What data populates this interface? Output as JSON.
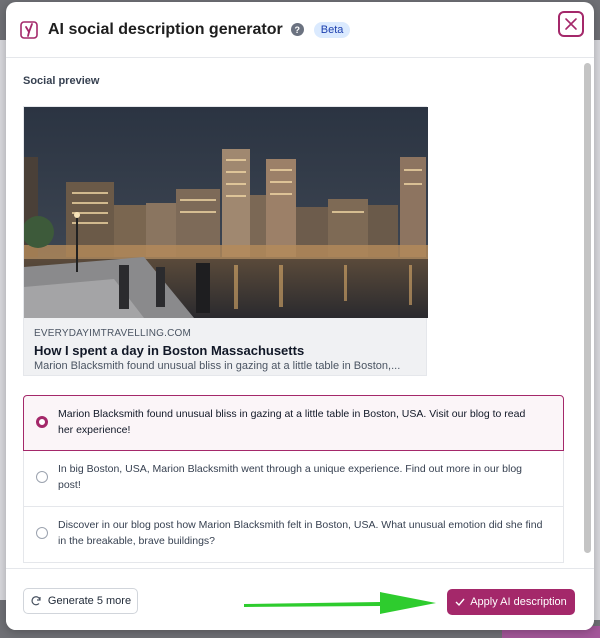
{
  "modal": {
    "title": "AI social description generator",
    "help_label": "?",
    "badge": "Beta"
  },
  "preview": {
    "section_label": "Social preview",
    "domain": "EVERYDAYIMTRAVELLING.COM",
    "title": "How I spent a day in Boston Massachusetts",
    "description": "Marion Blacksmith found unusual bliss in gazing at a little table in Boston,..."
  },
  "options": [
    {
      "text": "Marion Blacksmith found unusual bliss in gazing at a little table in Boston, USA. Visit our blog to read her experience!",
      "selected": true
    },
    {
      "text": "In big Boston, USA, Marion Blacksmith went through a unique experience. Find out more in our blog post!",
      "selected": false
    },
    {
      "text": "Discover in our blog post how Marion Blacksmith felt in Boston, USA. What unusual emotion did she find in the breakable, brave buildings?",
      "selected": false
    }
  ],
  "footer": {
    "generate_label": "Generate 5 more",
    "apply_label": "Apply AI description"
  },
  "colors": {
    "accent": "#a4286a",
    "annotation_arrow": "#2ecc2e"
  },
  "icons": {
    "logo": "yoast-icon",
    "help": "help-icon",
    "close": "close-icon",
    "generate": "refresh-icon",
    "apply": "check-icon",
    "annotation": "arrow-icon"
  }
}
